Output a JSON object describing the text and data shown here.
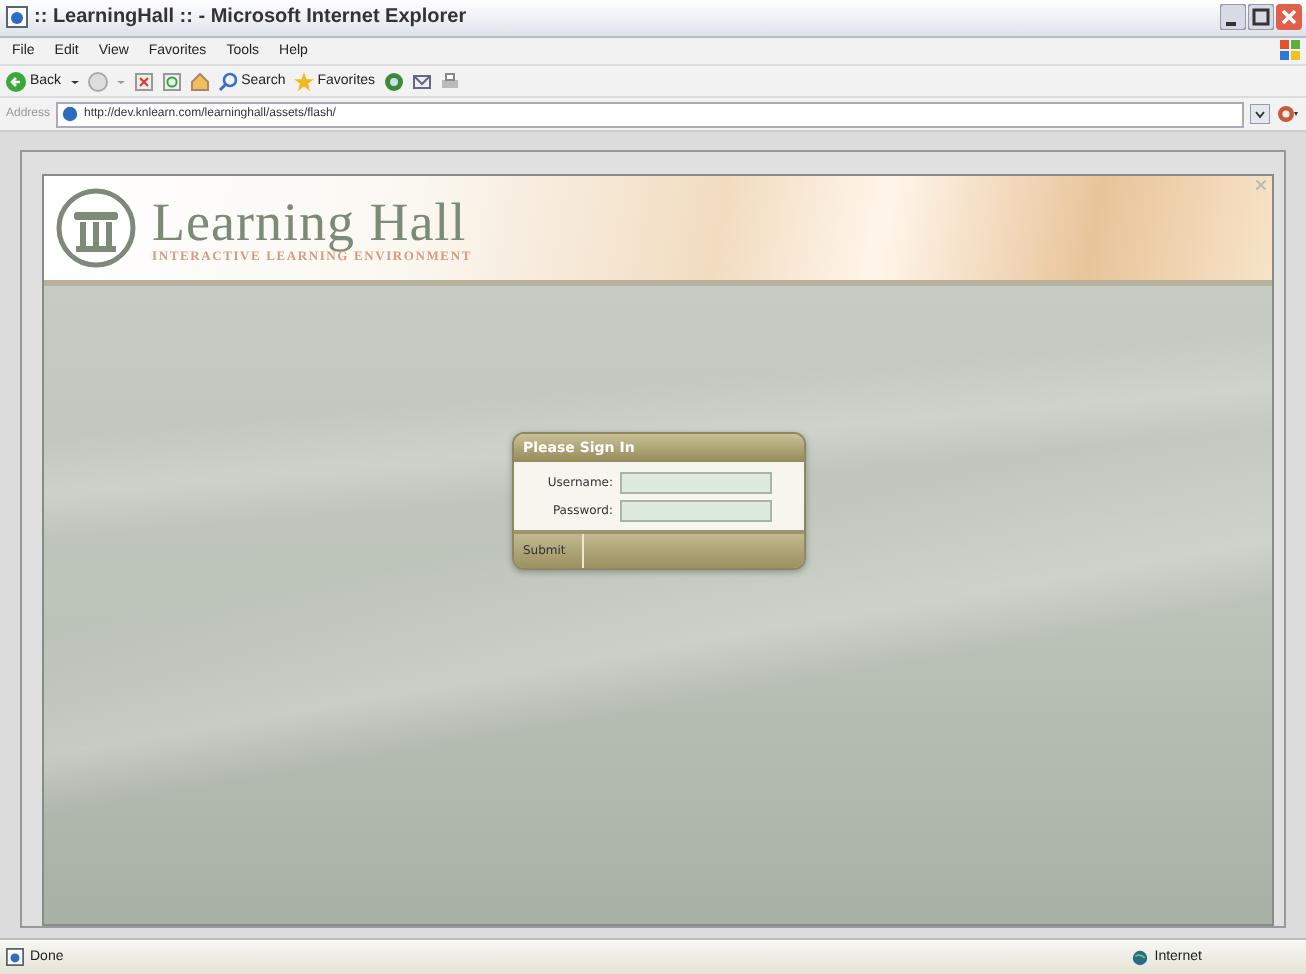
{
  "window": {
    "title": ":: LearningHall :: - Microsoft Internet Explorer"
  },
  "menu": [
    "File",
    "Edit",
    "View",
    "Favorites",
    "Tools",
    "Help"
  ],
  "toolbar": {
    "back": "Back",
    "search": "Search",
    "favorites": "Favorites"
  },
  "address": {
    "label": "Address",
    "value": "http://dev.knlearn.com/learninghall/assets/flash/"
  },
  "app": {
    "logo_title": "Learning Hall",
    "logo_subtitle": "INTERACTIVE LEARNING ENVIRONMENT",
    "login": {
      "title": "Please Sign In",
      "fields": [
        {
          "label": "Username:"
        },
        {
          "label": "Password:"
        }
      ],
      "submit": "Submit"
    }
  },
  "status_bar": {
    "text": "Done",
    "zone": "Internet"
  }
}
